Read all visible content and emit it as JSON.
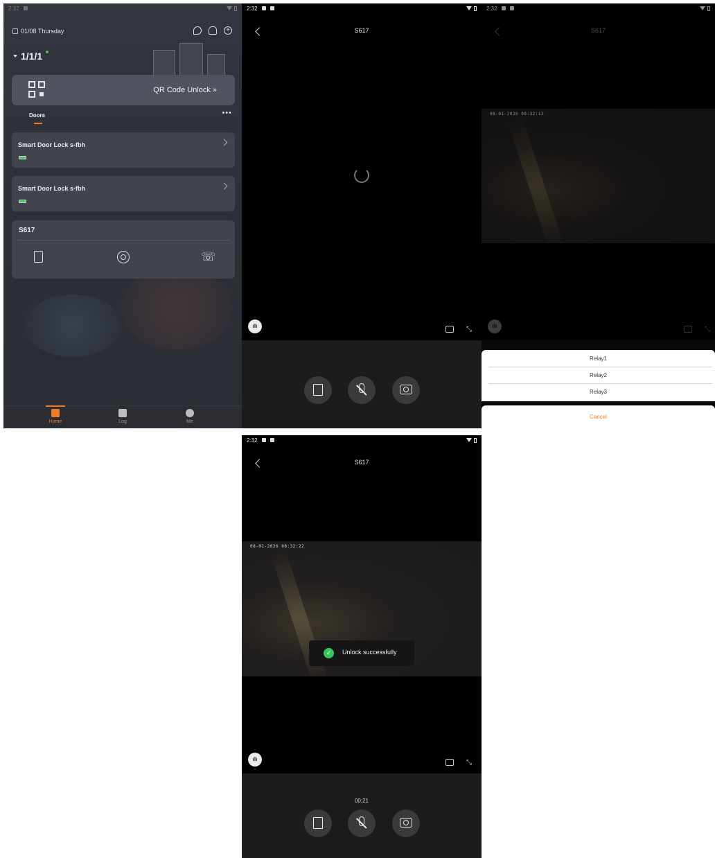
{
  "status_bar": {
    "time": "2:32"
  },
  "home": {
    "date": "01/08 Thursday",
    "site": "1/1/1",
    "qr_unlock": "QR Code Unlock »",
    "tab_doors": "Doors",
    "more": "•••",
    "locks": [
      {
        "name": "Smart Door Lock s-fbh"
      },
      {
        "name": "Smart Door Lock s-fbh"
      }
    ],
    "device_name": "S617",
    "nav": [
      {
        "label": "Home",
        "active": true
      },
      {
        "label": "Log",
        "active": false
      },
      {
        "label": "Me",
        "active": false
      }
    ],
    "accent_color": "#f07d2b"
  },
  "call": {
    "title": "S617",
    "timestamp_1": "08-01-2026 08:32:13",
    "timestamp_2": "08-01-2026 08:32:22",
    "relays": [
      "Relay1",
      "Relay2",
      "Relay3"
    ],
    "cancel": "Cancel",
    "toast": "Unlock successfully",
    "duration": "00:21"
  }
}
